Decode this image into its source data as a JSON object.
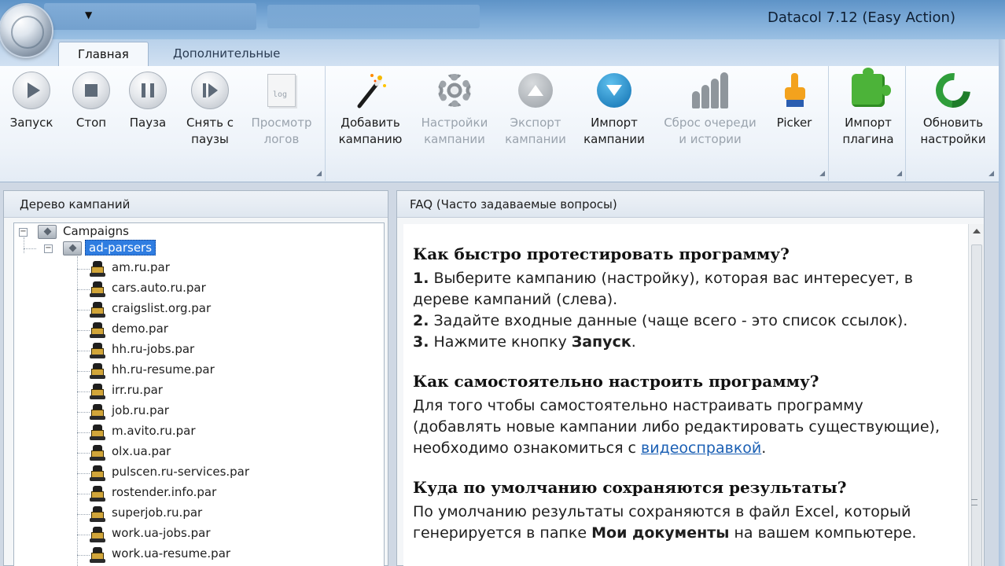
{
  "window": {
    "title": "Datacol 7.12 (Easy Action)"
  },
  "tabs": [
    {
      "label": "Главная",
      "active": true
    },
    {
      "label": "Дополнительные",
      "active": false
    }
  ],
  "ribbon": {
    "buttons": [
      {
        "label": "Запуск",
        "icon": "play-icon",
        "disabled": false
      },
      {
        "label": "Стоп",
        "icon": "stop-icon",
        "disabled": false
      },
      {
        "label": "Пауза",
        "icon": "pause-icon",
        "disabled": false
      },
      {
        "label": "Снять с\nпаузы",
        "icon": "resume-icon",
        "disabled": false
      },
      {
        "label": "Просмотр\nлогов",
        "icon": "log-document-icon",
        "disabled": true
      },
      {
        "label": "Добавить\nкампанию",
        "icon": "magic-wand-icon",
        "disabled": false
      },
      {
        "label": "Настройки\nкампании",
        "icon": "gear-icon",
        "disabled": true
      },
      {
        "label": "Экспорт\nкампании",
        "icon": "export-arrow-icon",
        "disabled": true
      },
      {
        "label": "Импорт\nкампании",
        "icon": "import-arrow-icon",
        "disabled": false
      },
      {
        "label": "Сброс очереди\nи истории",
        "icon": "people-queue-icon",
        "disabled": true
      },
      {
        "label": "Picker",
        "icon": "pointing-hand-icon",
        "disabled": false
      },
      {
        "label": "Импорт\nплагина",
        "icon": "puzzle-icon",
        "disabled": false
      },
      {
        "label": "Обновить\nнастройки",
        "icon": "refresh-icon",
        "disabled": false
      }
    ]
  },
  "tree_panel": {
    "title": "Дерево кампаний",
    "root": "Campaigns",
    "folder": "ad-parsers",
    "items": [
      "am.ru.par",
      "cars.auto.ru.par",
      "craigslist.org.par",
      "demo.par",
      "hh.ru-jobs.par",
      "hh.ru-resume.par",
      "irr.ru.par",
      "job.ru.par",
      "m.avito.ru.par",
      "olx.ua.par",
      "pulscen.ru-services.par",
      "rostender.info.par",
      "superjob.ru.par",
      "work.ua-jobs.par",
      "work.ua-resume.par"
    ]
  },
  "faq_panel": {
    "title": "FAQ (Часто задаваемые вопросы)",
    "q1": "Как быстро протестировать программу?",
    "q1_n1": "1.",
    "q1_s1": " Выберите кампанию (настройку), которая вас интересует, в дереве кампаний (слева).",
    "q1_n2": "2.",
    "q1_s2": " Задайте входные данные (чаще всего - это список ссылок).",
    "q1_n3": "3.",
    "q1_s3": " Нажмите кнопку ",
    "q1_s3_bold": "Запуск",
    "q1_s3_end": ".",
    "q2": "Как самостоятельно настроить программу?",
    "q2_text": "Для того чтобы самостоятельно настраивать программу (добавлять новые кампании либо редактировать существующие), необходимо ознакомиться с ",
    "q2_link": "видеосправкой",
    "q2_end": ".",
    "q3": "Куда по умолчанию сохраняются результаты?",
    "q3_text": "По умолчанию результаты сохраняются в файл Excel, который генерируется в папке ",
    "q3_bold": "Мои документы",
    "q3_end": " на вашем компьютере."
  }
}
